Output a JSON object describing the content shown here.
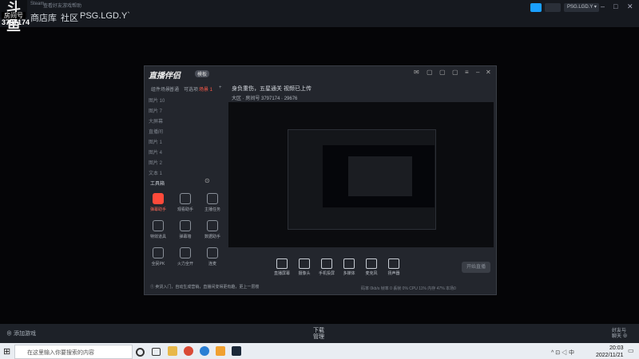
{
  "stream": {
    "overlay_tag": "房间号",
    "room_id": "3797174"
  },
  "steam": {
    "mini_menu": [
      "Steam",
      "查看",
      "好友",
      "游戏",
      "帮助"
    ],
    "nav": {
      "store": "商店",
      "library": "库",
      "community": "社区",
      "profile": "PSG.LGD.Y`"
    },
    "user_menu": "PSG.LGD.Y ▾",
    "add_game": "⊕ 添加游戏",
    "downloads_title": "下载",
    "downloads_sub": "管理",
    "friends_chat": "好友与\n聊天 ⊕",
    "brand_color": "#1a9fff"
  },
  "companion": {
    "title": "直播伴侣",
    "version": "模板",
    "tabs": [
      "组件场景",
      "普通",
      "可选项",
      "场景 1"
    ],
    "scenes": [
      "图片 10",
      "图片 7",
      "大屏幕",
      "直播间",
      "图片 1",
      "图片 4",
      "图片 2",
      "文本 1"
    ],
    "toolbox_title": "工具箱",
    "tools": [
      "弹幕助手",
      "观看助手",
      "主播任务",
      "特效道具",
      "弹幕墙",
      "数据助手",
      "全民PK",
      "火力全开",
      "连麦"
    ],
    "tip": "① 卖货入门，自动生成营销，直播间变得更有趣，更上一层楼",
    "stream_title": "身负重伤，五星通关 视频已上传",
    "stream_meta": "大区 · 房间号 3797174 · 29676",
    "controls": [
      "直播屏幕",
      "摄像头",
      "手机投屏",
      "多媒体",
      "麦克风",
      "扬声器"
    ],
    "start_live": "开始直播",
    "stats": "码率 0kb/s   帧率 0   丢帧 0%   CPU 11%   内存 47%   本场0"
  },
  "taskbar": {
    "search_placeholder": "在这里输入你要搜索的内容",
    "tray": "^ ⊡ ◁ 中",
    "time": "20:03",
    "date": "2022/11/21"
  }
}
